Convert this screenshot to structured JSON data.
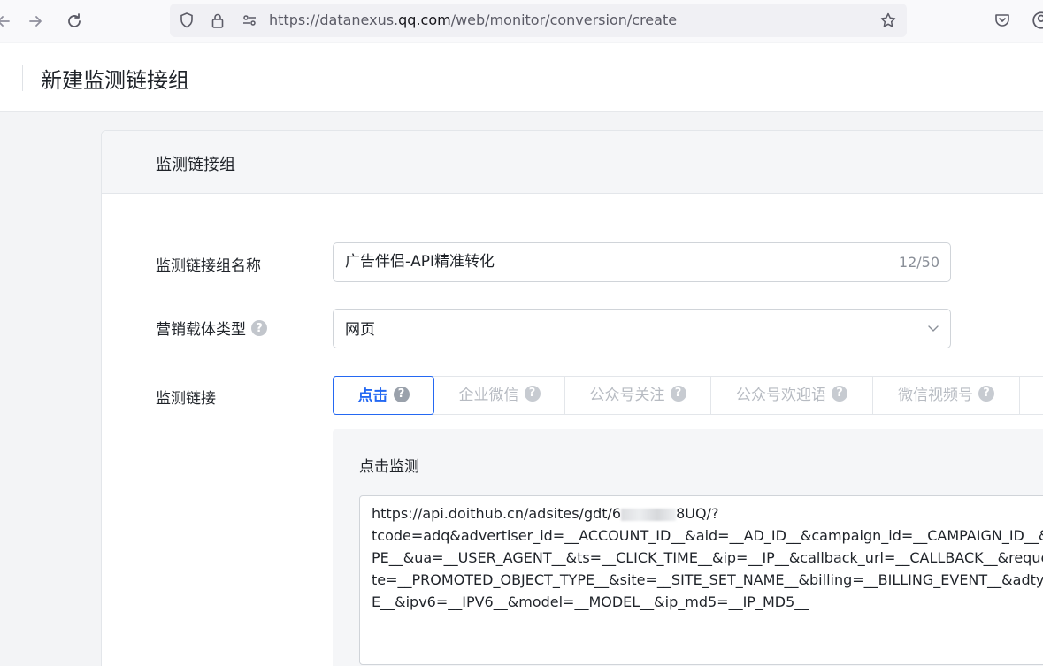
{
  "browser": {
    "url_prefix": "https://datanexus.",
    "url_host": "qq.com",
    "url_path": "/web/monitor/conversion/create"
  },
  "page": {
    "title": "新建监测链接组"
  },
  "card": {
    "title": "监测链接组",
    "name_label": "监测链接组名称",
    "name_value": "广告伴侣-API精准转化",
    "name_counter": "12/50",
    "carrier_label": "营销载体类型",
    "carrier_value": "网页",
    "link_label": "监测链接",
    "tabs": [
      {
        "label": "点击",
        "active": true
      },
      {
        "label": "企业微信",
        "active": false
      },
      {
        "label": "公众号关注",
        "active": false
      },
      {
        "label": "公众号欢迎语",
        "active": false
      },
      {
        "label": "微信视频号",
        "active": false
      }
    ],
    "panel_title": "点击监测",
    "textarea_lines": {
      "l1_start": "https://api.doithub.cn/adsites/gdt/6",
      "l1_end": "8UQ/?",
      "l2": "tcode=adq&advertiser_id=__ACCOUNT_ID__&aid=__AD_ID__&campaign_id=__CAMPAIGN_ID__&cid",
      "l3": "PE__&ua=__USER_AGENT__&ts=__CLICK_TIME__&ip=__IP__&callback_url=__CALLBACK__&request_i",
      "l4": "te=__PROMOTED_OBJECT_TYPE__&site=__SITE_SET_NAME__&billing=__BILLING_EVENT__&adtype=",
      "l5": "E__&ipv6=__IPV6__&model=__MODEL__&ip_md5=__IP_MD5__"
    }
  },
  "help_glyph": "?",
  "colors": {
    "accent": "#2468f2",
    "muted_tab": "#b7bbc2"
  }
}
